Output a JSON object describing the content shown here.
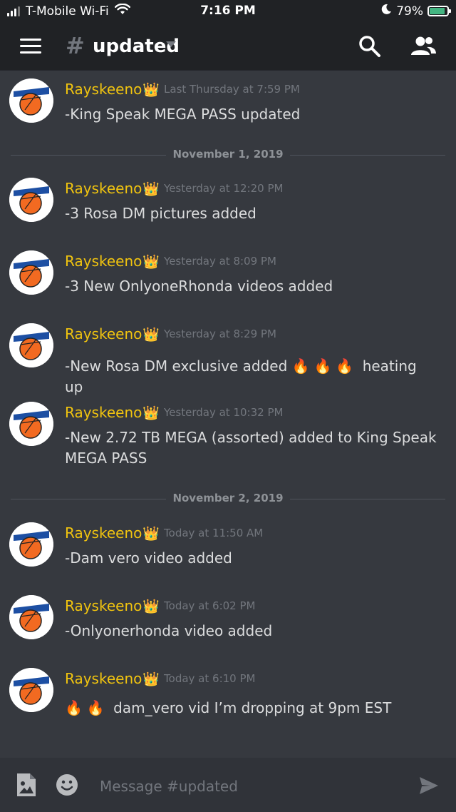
{
  "status_bar": {
    "carrier": "T-Mobile Wi-Fi",
    "time": "7:16 PM",
    "battery": "79%",
    "battery_level": 0.79
  },
  "header": {
    "hash": "#",
    "channel_name": "updated",
    "icons": [
      "menu-icon",
      "search-icon",
      "members-icon"
    ]
  },
  "colors": {
    "author": "#f1c40f",
    "background": "#36393f",
    "header": "#202225"
  },
  "messages": [
    {
      "author": "Rayskeeno",
      "crown": "👑",
      "timestamp": "Last Thursday at 7:59 PM",
      "text": "-King Speak MEGA PASS updated"
    },
    {
      "author": "Rayskeeno",
      "crown": "👑",
      "timestamp": "Yesterday at 12:20 PM",
      "text": "-3 Rosa DM pictures added"
    },
    {
      "author": "Rayskeeno",
      "crown": "👑",
      "timestamp": "Yesterday at 8:09 PM",
      "text": "-3 New OnlyoneRhonda videos added"
    },
    {
      "author": "Rayskeeno",
      "crown": "👑",
      "timestamp": "Yesterday at 8:29 PM",
      "text": "-New Rosa DM exclusive added",
      "fires": "🔥🔥🔥",
      "text_after": " heating up"
    },
    {
      "author": "Rayskeeno",
      "crown": "👑",
      "timestamp": "Yesterday at 10:32 PM",
      "text": "-New 2.72 TB MEGA (assorted) added to King Speak MEGA PASS"
    },
    {
      "author": "Rayskeeno",
      "crown": "👑",
      "timestamp": "Today at 11:50 AM",
      "text": "-Dam vero video added"
    },
    {
      "author": "Rayskeeno",
      "crown": "👑",
      "timestamp": "Today at 6:02 PM",
      "text": "-Onlyonerhonda video added"
    },
    {
      "author": "Rayskeeno",
      "crown": "👑",
      "timestamp": "Today at 6:10 PM",
      "fires": "🔥🔥",
      "text": " dam_vero vid I’m dropping at 9pm EST"
    }
  ],
  "dividers": [
    "November 1, 2019",
    "November 2, 2019"
  ],
  "composer": {
    "placeholder": "Message #updated",
    "icons": [
      "image-icon",
      "emoji-icon",
      "send-icon"
    ]
  }
}
